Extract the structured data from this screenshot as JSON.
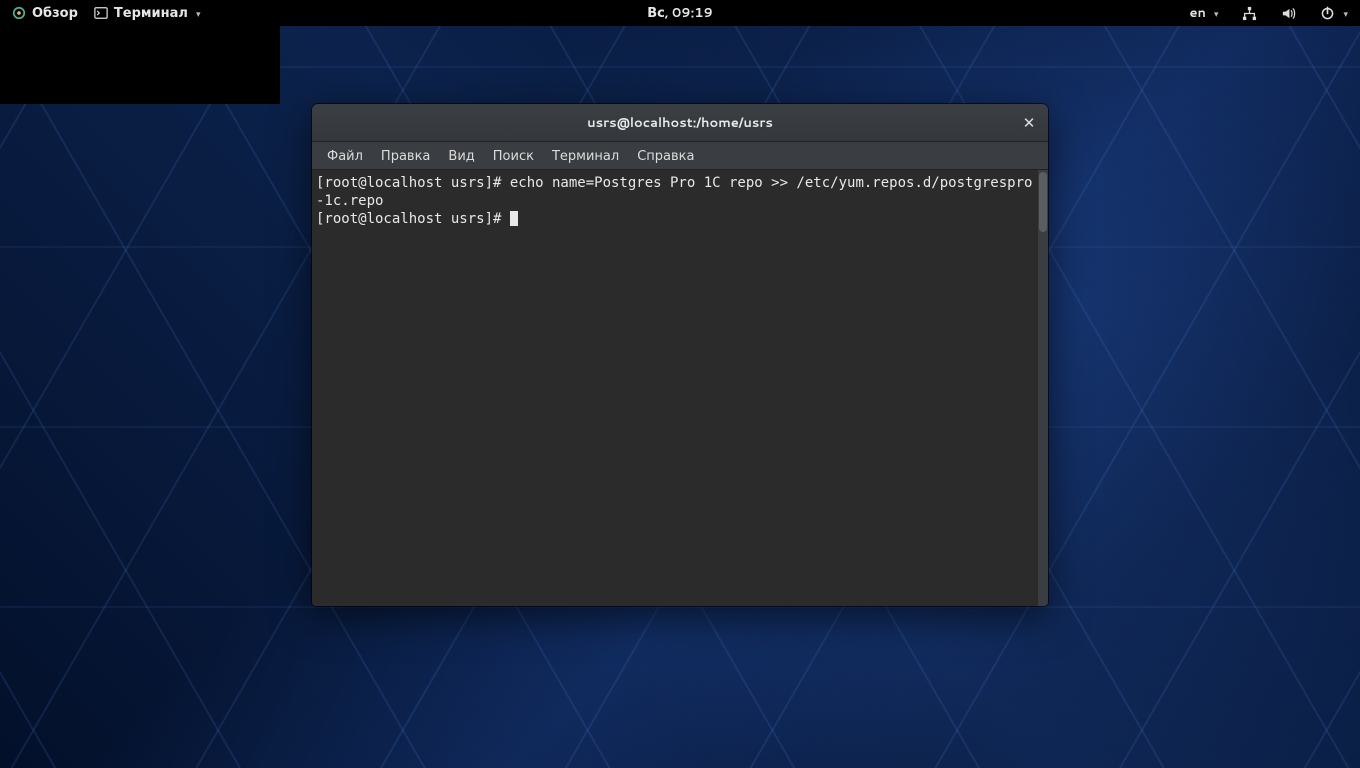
{
  "topbar": {
    "overview_label": "Обзор",
    "app_label": "Терминал",
    "clock": "Вс, 09:19",
    "lang": "en"
  },
  "window": {
    "title": "usrs@localhost:/home/usrs",
    "menus": {
      "file": "Файл",
      "edit": "Правка",
      "view": "Вид",
      "search": "Поиск",
      "terminal": "Терминал",
      "help": "Справка"
    }
  },
  "terminal": {
    "line1": "[root@localhost usrs]# echo name=Postgres Pro 1C repo >> /etc/yum.repos.d/postgrespro-1c.repo",
    "prompt2": "[root@localhost usrs]# "
  }
}
